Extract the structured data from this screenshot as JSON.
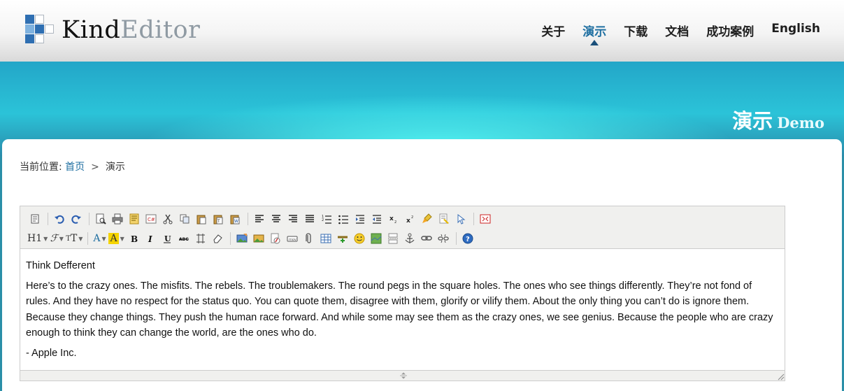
{
  "logo": {
    "word1": "Kind",
    "word2": "Editor"
  },
  "nav": {
    "items": [
      {
        "label": "关于"
      },
      {
        "label": "演示"
      },
      {
        "label": "下载"
      },
      {
        "label": "文档"
      },
      {
        "label": "成功案例"
      },
      {
        "label": "English"
      }
    ],
    "active_index": 1
  },
  "banner": {
    "title_cn": "演示",
    "title_en": "Demo"
  },
  "breadcrumb": {
    "prefix": "当前位置:",
    "home": "首页",
    "separator": ">",
    "current": "演示"
  },
  "editor": {
    "toolbar_row1": [
      "source",
      "undo",
      "redo",
      "preview",
      "print",
      "template",
      "code",
      "cut",
      "copy",
      "paste",
      "paste-plain",
      "paste-word",
      "justify-left",
      "justify-center",
      "justify-right",
      "justify-full",
      "ordered-list",
      "unordered-list",
      "indent",
      "outdent",
      "subscript",
      "superscript",
      "clear-html",
      "quick-format",
      "select-all",
      "fullscreen"
    ],
    "toolbar_row2": [
      "heading",
      "font-name",
      "font-size",
      "fore-color",
      "hilite-color",
      "bold",
      "italic",
      "underline",
      "strikethrough",
      "line-height",
      "remove-format",
      "image",
      "multi-image",
      "flash",
      "media",
      "insert-file",
      "table",
      "horizontal-rule",
      "emoticons",
      "baidu-map",
      "page-break",
      "anchor",
      "link",
      "unlink",
      "about"
    ],
    "heading_label": "H1",
    "fore_color_label": "A",
    "hilite_color_label": "A",
    "content": {
      "line1": "Think Defferent",
      "paragraph": "Here’s to the crazy ones. The misfits. The rebels. The troublemakers. The round pegs in the square holes. The ones who see things differently. They’re not fond of rules. And they have no respect for the status quo. You can quote them, disagree with them, glorify or vilify them. About the only thing you can’t do is ignore them. Because they change things. They push the human race forward. And while some may see them as the crazy ones, we see genius. Because the people who are crazy enough to think they can change the world, are the ones who do.",
      "signature": "- Apple Inc."
    }
  },
  "colors": {
    "accent": "#1f6fa1",
    "banner_glow": "#4ff0f0"
  }
}
